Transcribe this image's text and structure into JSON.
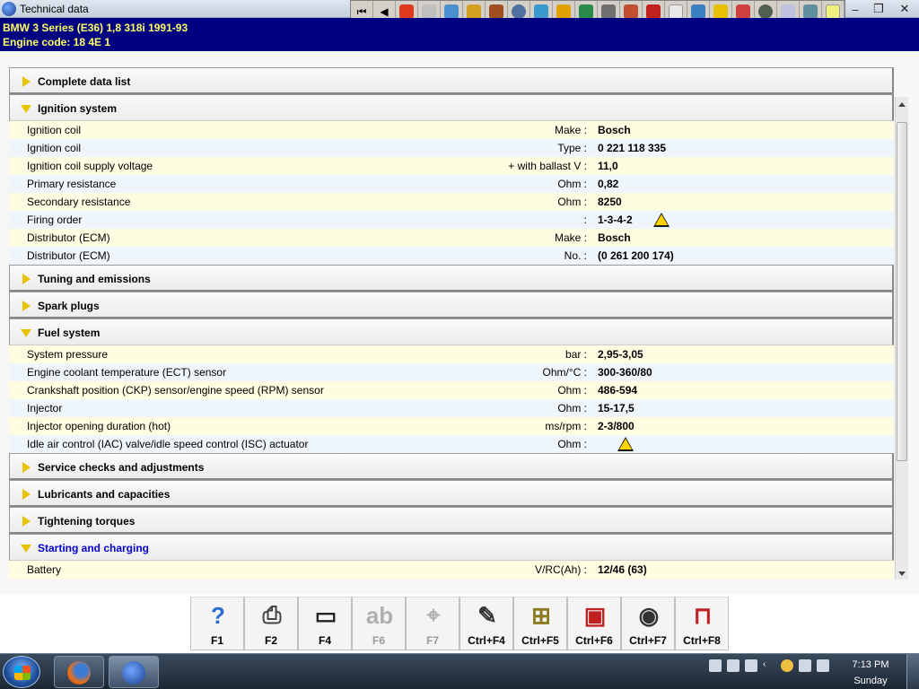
{
  "window": {
    "title": "Technical data"
  },
  "header": {
    "vehicle": "BMW   3 Series (E36) 1,8 318i 1991-93",
    "engine_code": "Engine code: 18 4E 1"
  },
  "sections": {
    "complete": "Complete data list",
    "ignition": "Ignition system",
    "tuning": "Tuning and emissions",
    "spark": "Spark plugs",
    "fuel": "Fuel system",
    "service": "Service checks and adjustments",
    "lubricants": "Lubricants and capacities",
    "torques": "Tightening torques",
    "starting": "Starting and charging"
  },
  "ignition_rows": [
    {
      "name": "Ignition coil",
      "unit": "Make :",
      "value": "Bosch"
    },
    {
      "name": "Ignition coil",
      "unit": "Type :",
      "value": "0 221 118 335"
    },
    {
      "name": "Ignition coil supply voltage",
      "unit": "+ with ballast   V :",
      "value": "11,0"
    },
    {
      "name": "Primary resistance",
      "unit": "Ohm :",
      "value": "0,82"
    },
    {
      "name": "Secondary resistance",
      "unit": "Ohm :",
      "value": "8250"
    },
    {
      "name": "Firing order",
      "unit": ":",
      "value": "1-3-4-2"
    },
    {
      "name": "Distributor (ECM)",
      "unit": "Make :",
      "value": "Bosch"
    },
    {
      "name": "Distributor (ECM)",
      "unit": "No. :",
      "value": "(0 261 200 174)"
    }
  ],
  "fuel_rows": [
    {
      "name": "System pressure",
      "unit": "bar :",
      "value": "2,95-3,05"
    },
    {
      "name": "Engine coolant temperature (ECT) sensor",
      "unit": "Ohm/°C :",
      "value": "300-360/80"
    },
    {
      "name": "Crankshaft position (CKP) sensor/engine speed (RPM) sensor",
      "unit": "Ohm :",
      "value": "486-594"
    },
    {
      "name": "Injector",
      "unit": "Ohm :",
      "value": "15-17,5"
    },
    {
      "name": "Injector opening duration (hot)",
      "unit": "ms/rpm :",
      "value": "2-3/800"
    },
    {
      "name": "Idle air control (IAC) valve/idle speed control (ISC) actuator",
      "unit": "Ohm :",
      "value": ""
    }
  ],
  "starting_rows": [
    {
      "name": "Battery",
      "unit": "V/RC(Ah) :",
      "value": "12/46 (63)"
    }
  ],
  "fkeys": [
    {
      "key": "F1",
      "icon": "help-icon",
      "enabled": true
    },
    {
      "key": "F2",
      "icon": "printer-icon",
      "enabled": true
    },
    {
      "key": "F4",
      "icon": "monitor-icon",
      "enabled": true
    },
    {
      "key": "F6",
      "icon": "letters-icon",
      "enabled": false
    },
    {
      "key": "F7",
      "icon": "crosshair-icon",
      "enabled": false
    },
    {
      "key": "Ctrl+F4",
      "icon": "notes-icon",
      "enabled": true
    },
    {
      "key": "Ctrl+F5",
      "icon": "add-sheet-icon",
      "enabled": true
    },
    {
      "key": "Ctrl+F6",
      "icon": "component-icon",
      "enabled": true
    },
    {
      "key": "Ctrl+F7",
      "icon": "gauges-icon",
      "enabled": true
    },
    {
      "key": "Ctrl+F8",
      "icon": "lift-icon",
      "enabled": true
    }
  ],
  "taskbar": {
    "time": "7:13 PM",
    "day": "Sunday"
  },
  "colors": {
    "header_bg": "#000080",
    "header_text": "#ffff66",
    "row_odd": "#fefde2",
    "row_even": "#eef6fb",
    "arrow": "#e6c400"
  }
}
